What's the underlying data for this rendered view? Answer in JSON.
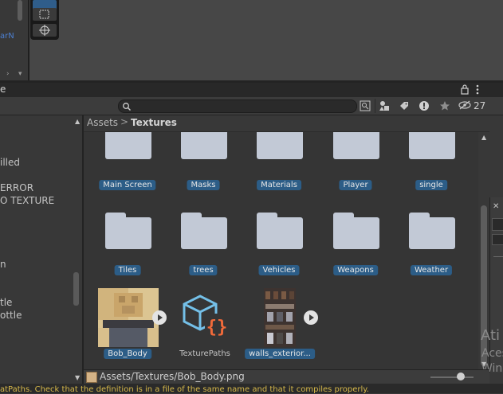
{
  "top": {
    "left_blue_text": "arN",
    "arrow_right": "›",
    "arrow_down": "▾"
  },
  "panel": {
    "tab_label": "e",
    "lock_icon": "lock-icon",
    "menu_icon": "kebab-menu-icon"
  },
  "toolbar": {
    "search_placeholder": "",
    "hidden_count": "27"
  },
  "tree": {
    "items": [
      "illed",
      "ERROR",
      "O TEXTURE",
      "n",
      "tle",
      "ottle"
    ]
  },
  "breadcrumb": {
    "root": "Assets",
    "separator": ">",
    "current": "Textures"
  },
  "grid": {
    "folders_row1": [
      "Main Screen",
      "Masks",
      "Materials",
      "Player",
      "single"
    ],
    "folders_row2": [
      "Tiles",
      "trees",
      "Vehicles",
      "Weapons",
      "Weather"
    ],
    "assets": [
      {
        "label": "Bob_Body",
        "kind": "texture",
        "selected": true
      },
      {
        "label": "TexturePaths",
        "kind": "script",
        "selected": false
      },
      {
        "label": "walls_exterior...",
        "kind": "texture",
        "selected": true
      }
    ]
  },
  "status": {
    "path": "Assets/Textures/Bob_Body.png",
    "zoom_level": 0.7
  },
  "right_edge": {
    "line1": "Ati",
    "line2": "Aces",
    "line3": "Win"
  },
  "console": {
    "message": "atPaths. Check that the definition is in a file of the same name and that it compiles properly."
  },
  "colors": {
    "label_blue": "#2c5d87",
    "folder": "#c2c9d6",
    "background": "#383838",
    "warning": "#d6b84a"
  }
}
